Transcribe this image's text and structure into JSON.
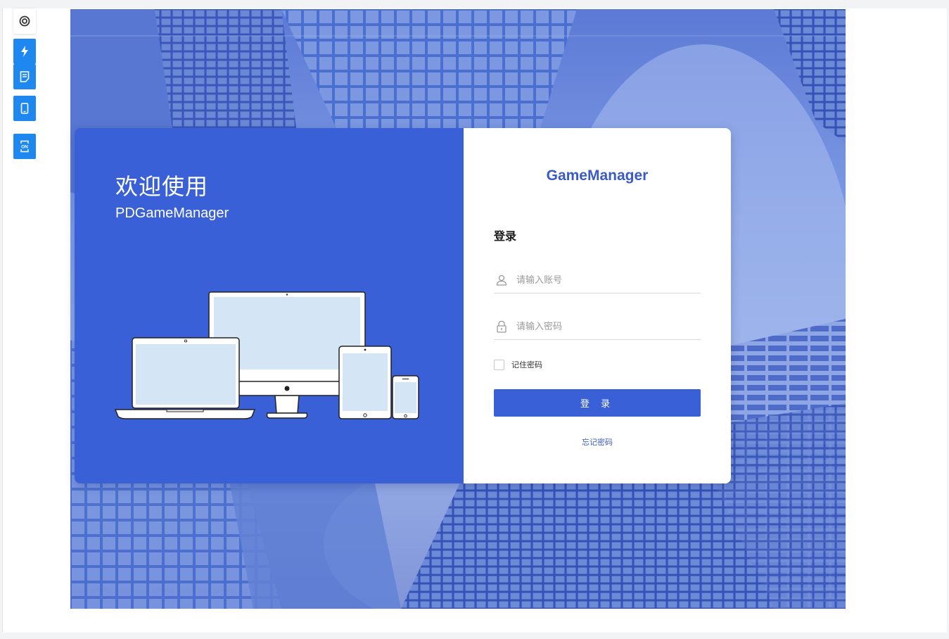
{
  "toolbar": {
    "items": [
      {
        "icon": "target-icon"
      },
      {
        "icon": "lightning-icon"
      },
      {
        "icon": "document-icon"
      },
      {
        "icon": "mobile-icon"
      },
      {
        "icon": "on-toggle-icon",
        "label": "ON"
      }
    ]
  },
  "welcome": {
    "title": "欢迎使用",
    "subtitle": "PDGameManager"
  },
  "login": {
    "brand": "GameManager",
    "heading": "登录",
    "account_placeholder": "请输入账号",
    "password_placeholder": "请输入密码",
    "remember_label": "记住密码",
    "remember_checked": false,
    "submit_label": "登 录",
    "forgot_label": "忘记密码"
  },
  "colors": {
    "primary": "#3a60d8",
    "brand_text": "#3a5bc7",
    "rail_blue": "#1e88f0"
  }
}
